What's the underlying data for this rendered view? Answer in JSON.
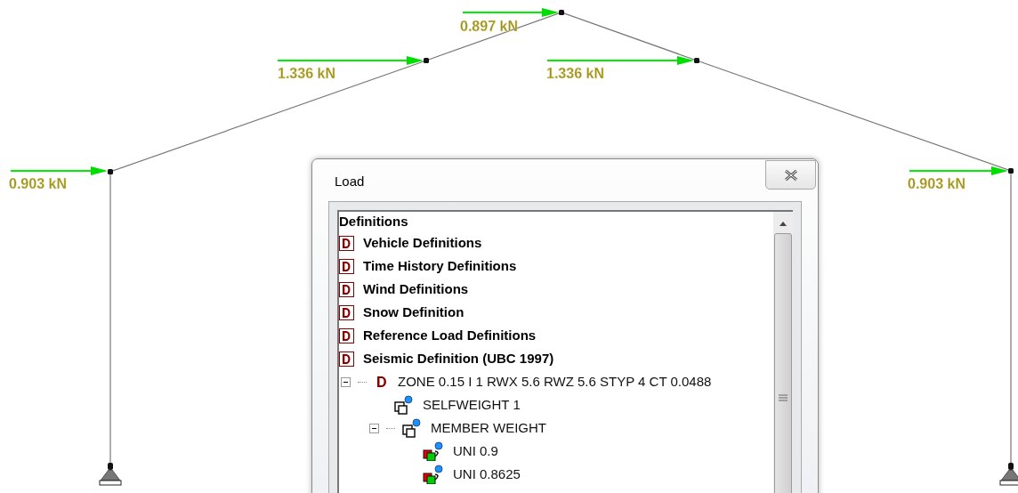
{
  "structure": {
    "loads": [
      {
        "label": "0.903 kN"
      },
      {
        "label": "1.336 kN"
      },
      {
        "label": "0.897 kN"
      },
      {
        "label": "1.336 kN"
      },
      {
        "label": "0.903 kN"
      }
    ]
  },
  "dialog": {
    "title": "Load",
    "tree": {
      "heading": "Definitions",
      "items": [
        {
          "kind": "definition",
          "label": "Vehicle Definitions"
        },
        {
          "kind": "definition",
          "label": "Time History Definitions"
        },
        {
          "kind": "definition",
          "label": "Wind Definitions"
        },
        {
          "kind": "definition",
          "label": "Snow Definition"
        },
        {
          "kind": "definition",
          "label": "Reference Load Definitions"
        },
        {
          "kind": "definition",
          "label": "Seismic Definition (UBC 1997)",
          "children": [
            {
              "kind": "seismic",
              "label": "ZONE 0.15 I 1 RWX 5.6 RWZ 5.6 STYP 4 CT 0.0488",
              "expanded": true,
              "children": [
                {
                  "kind": "weight",
                  "label": "SELFWEIGHT 1"
                },
                {
                  "kind": "weight",
                  "label": "MEMBER WEIGHT",
                  "expanded": true,
                  "children": [
                    {
                      "kind": "uniform",
                      "label": "UNI 0.9"
                    },
                    {
                      "kind": "uniform",
                      "label": "UNI 0.8625"
                    }
                  ]
                }
              ]
            }
          ]
        }
      ]
    }
  }
}
